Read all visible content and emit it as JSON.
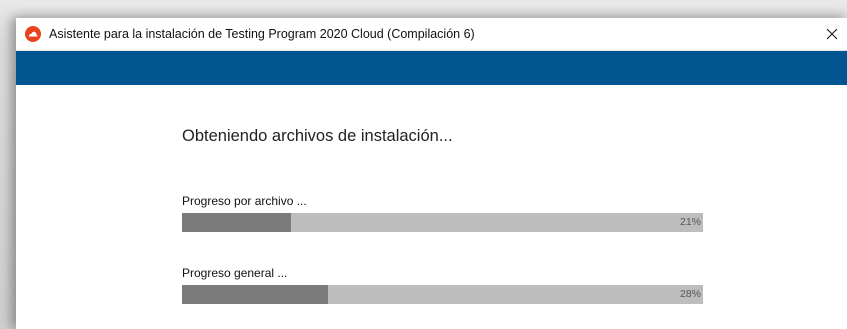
{
  "window": {
    "title": "Asistente para la instalación de Testing Program 2020 Cloud (Compilación 6)",
    "close_symbol": "✕",
    "icon": "app-logo-icon",
    "banner_color": "#00548f",
    "icon_color": "#e8451e"
  },
  "main": {
    "heading": "Obteniendo archivos de instalación...",
    "file_progress": {
      "label": "Progreso por archivo ...",
      "value": 21,
      "value_text": "21%"
    },
    "overall_progress": {
      "label": "Progreso general ...",
      "value": 28,
      "value_text": "28%"
    }
  }
}
